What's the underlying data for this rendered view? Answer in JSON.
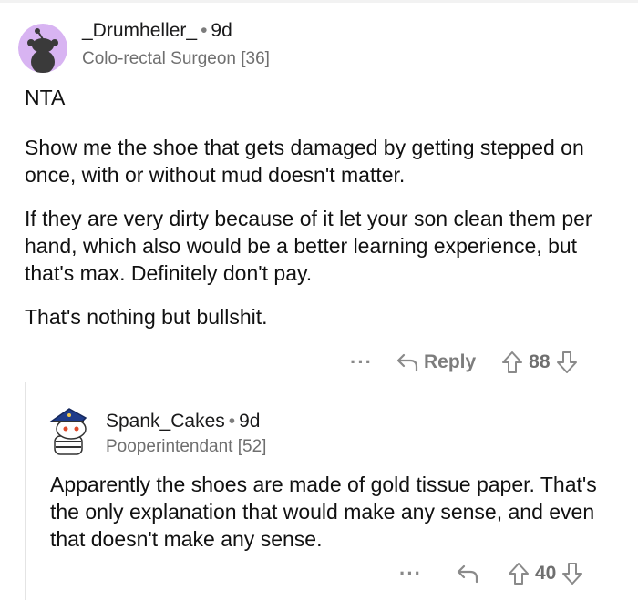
{
  "comments": [
    {
      "username": "_Drumheller_",
      "age": "9d",
      "flair": "Colo-rectal Surgeon [36]",
      "paragraphs": [
        "NTA",
        "Show me the shoe that gets damaged by getting stepped on once, with or without mud doesn't matter.",
        "If they are very dirty because of it let your son clean them per hand, which also would be a better learning experience, but that's max. Definitely don't pay.",
        "That's nothing but bullshit."
      ],
      "more": "···",
      "reply_label": "Reply",
      "score": "88"
    },
    {
      "username": "Spank_Cakes",
      "age": "9d",
      "flair": "Pooperintendant [52]",
      "paragraphs": [
        "Apparently the shoes are made of gold tissue paper. That's the only explanation that would make any sense, and even that doesn't make any sense."
      ],
      "more": "···",
      "score": "40"
    }
  ],
  "separator": "•",
  "colors": {
    "avatar_bg": "#d8b4f2",
    "snoo": "#3a3a3a",
    "action_gray": "#8a8a8a",
    "thread_line": "#e4e4e4"
  },
  "icons": [
    "more-icon",
    "reply-arrow-icon",
    "upvote-icon",
    "downvote-icon"
  ]
}
